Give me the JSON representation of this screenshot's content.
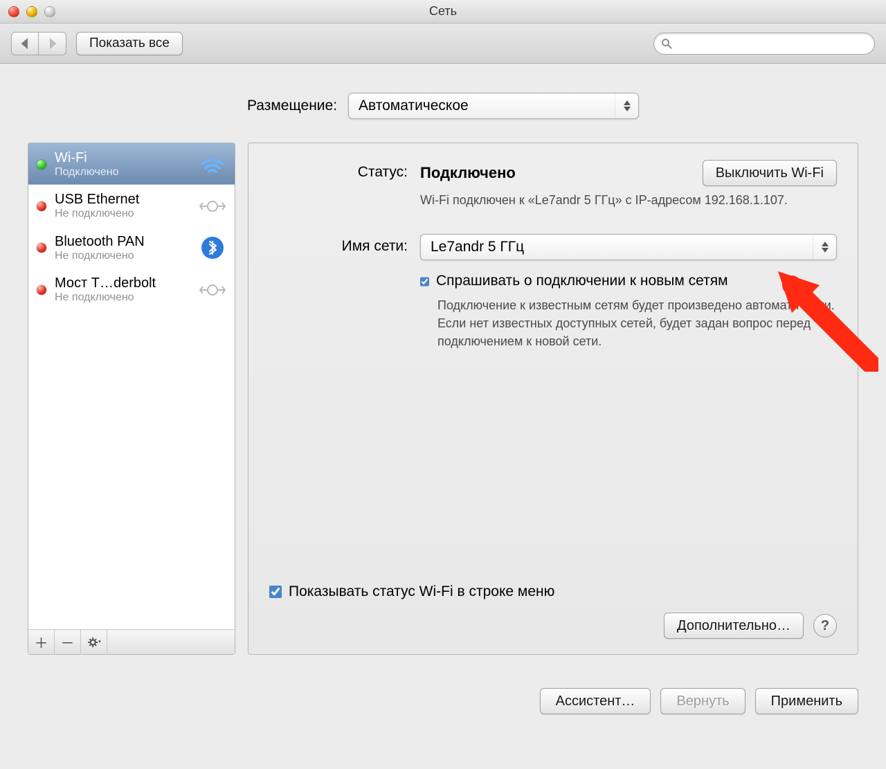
{
  "window": {
    "title": "Сеть"
  },
  "toolbar": {
    "show_all": "Показать все",
    "search_placeholder": ""
  },
  "location": {
    "label": "Размещение:",
    "value": "Автоматическое"
  },
  "sidebar": {
    "items": [
      {
        "title": "Wi-Fi",
        "sub": "Подключено",
        "status": "green",
        "icon": "wifi",
        "selected": true
      },
      {
        "title": "USB Ethernet",
        "sub": "Не подключено",
        "status": "red",
        "icon": "ethernet",
        "selected": false
      },
      {
        "title": "Bluetooth PAN",
        "sub": "Не подключено",
        "status": "red",
        "icon": "bluetooth",
        "selected": false
      },
      {
        "title": "Мост T…derbolt",
        "sub": "Не подключено",
        "status": "red",
        "icon": "ethernet",
        "selected": false
      }
    ]
  },
  "detail": {
    "status_label": "Статус:",
    "status_value": "Подключено",
    "turn_off_button": "Выключить Wi-Fi",
    "status_desc": "Wi-Fi подключен к «Le7andr 5 ГГц» с IP-адресом 192.168.1.107.",
    "network_name_label": "Имя сети:",
    "network_name_value": "Le7andr 5 ГГц",
    "ask_checkbox_label": "Спрашивать о подключении к новым сетям",
    "ask_checkbox_checked": true,
    "ask_desc": "Подключение к известным сетям будет произведено автоматически. Если нет известных доступных сетей, будет задан вопрос перед подключением к новой сети.",
    "show_status_label": "Показывать статус Wi-Fi в строке меню",
    "show_status_checked": true,
    "advanced_button": "Дополнительно…"
  },
  "buttons": {
    "assistant": "Ассистент…",
    "revert": "Вернуть",
    "apply": "Применить"
  }
}
